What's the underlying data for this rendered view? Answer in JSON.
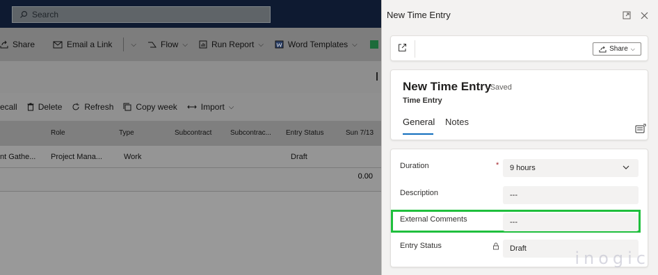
{
  "topbar": {
    "search_placeholder": "Search"
  },
  "commandbar": {
    "share": "Share",
    "email_link": "Email a Link",
    "flow": "Flow",
    "run_report": "Run Report",
    "word_templates": "Word Templates"
  },
  "subbar": {
    "recall": "ecall",
    "delete": "Delete",
    "refresh": "Refresh",
    "copy_week": "Copy week",
    "import": "Import"
  },
  "grid": {
    "columns": [
      "Role",
      "Type",
      "Subcontract",
      "Subcontrac...",
      "Entry Status",
      "Sun 7/13"
    ],
    "row": {
      "task": "nt Gathe...",
      "role": "Project Mana...",
      "type": "Work",
      "entry_status": "Draft"
    },
    "total": "0.00"
  },
  "panel": {
    "title": "New Time Entry",
    "share_label": "Share",
    "record_title": "New Time Entry",
    "record_status": "- Saved",
    "entity": "Time Entry",
    "tabs": [
      "General",
      "Notes"
    ],
    "fields": {
      "duration": {
        "label": "Duration",
        "value": "9 hours",
        "required_mark": "*"
      },
      "description": {
        "label": "Description",
        "value": "---"
      },
      "external_comments": {
        "label": "External Comments",
        "value": "---"
      },
      "entry_status": {
        "label": "Entry Status",
        "value": "Draft"
      }
    },
    "highlight_color": "#1fbf3d",
    "accent_color": "#0f6cbd"
  },
  "watermark": "inogic"
}
